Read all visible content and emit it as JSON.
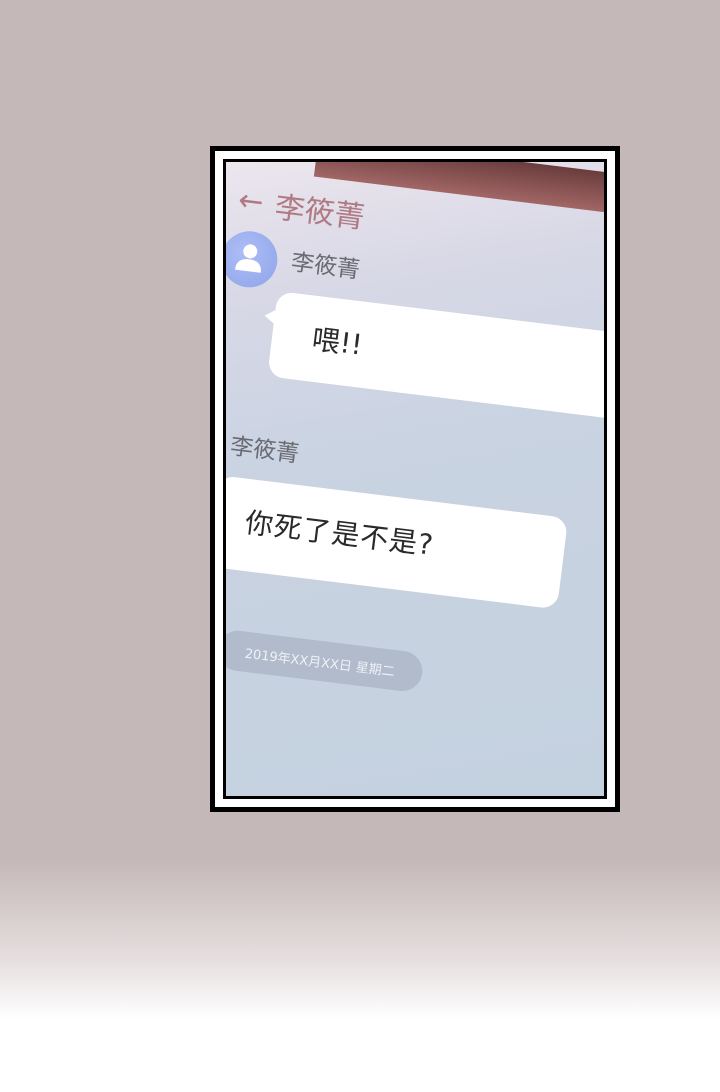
{
  "chat": {
    "header_title": "李筱菁",
    "messages": [
      {
        "sender": "李筱菁",
        "text": "喂!!"
      },
      {
        "sender": "李筱菁",
        "text": "你死了是不是?"
      }
    ],
    "date_label": "2019年XX月XX日 星期二"
  },
  "icons": {
    "back": "back-arrow-icon",
    "avatar": "user-avatar-icon"
  },
  "colors": {
    "background": "#c5b8b8",
    "header_text": "#b07a83",
    "avatar": "#9aaeee",
    "bubble": "#ffffff"
  }
}
